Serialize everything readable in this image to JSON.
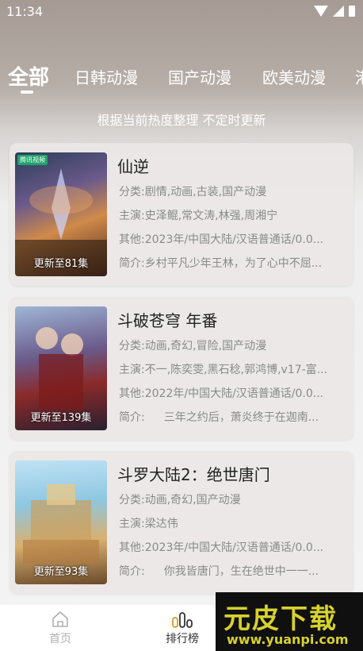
{
  "status": {
    "time": "11:34"
  },
  "tabs": [
    "全部",
    "日韩动漫",
    "国产动漫",
    "欧美动漫",
    "港"
  ],
  "subtitle": "根据当前热度整理 不定时更新",
  "labels": {
    "category": "分类:",
    "cast": "主演:",
    "other": "其他:",
    "intro": "简介:"
  },
  "items": [
    {
      "title": "仙逆",
      "poster_tag": "腾讯视频",
      "update": "更新至81集",
      "category": "剧情,动画,古装,国产动漫",
      "cast": "史泽鲲,常文涛,林强,周湘宁",
      "other": "2023年/中国大陆/汉语普通话/0.0...",
      "intro": "乡村平凡少年王林，为了心中不屈..."
    },
    {
      "title": "斗破苍穹 年番",
      "poster_tag": "",
      "update": "更新至139集",
      "category": "动画,奇幻,冒险,国产动漫",
      "cast": "不一,陈奕雯,黑石稔,郭鸿博,v17-富...",
      "other": "2022年/中国大陆/汉语普通话/0.0...",
      "intro": "三年之约后，萧炎终于在迦南..."
    },
    {
      "title": "斗罗大陆2：绝世唐门",
      "poster_tag": "",
      "update": "更新至93集",
      "category": "动画,奇幻,国产动漫",
      "cast": "梁达伟",
      "other": "2023年/中国大陆/汉语普通话/0.0...",
      "intro": "你我皆唐门，生在绝世中一一..."
    }
  ],
  "nav": {
    "home": "首页",
    "rank": "排行榜"
  },
  "watermark": {
    "main": "元皮下载",
    "url": "www.yuanpi.com"
  }
}
